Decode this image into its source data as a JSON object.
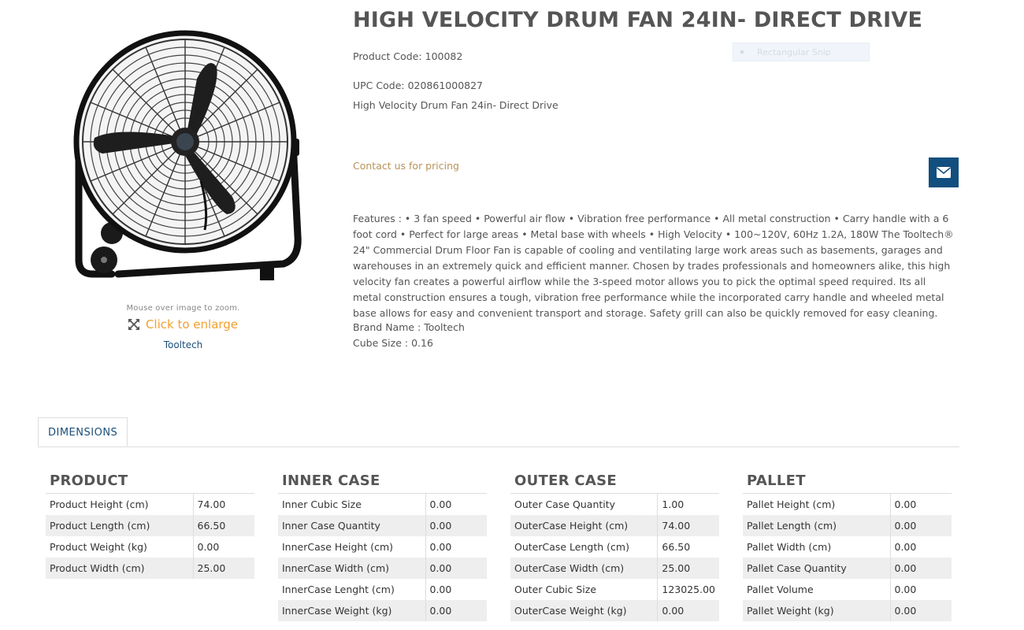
{
  "product": {
    "title": "HIGH VELOCITY DRUM FAN 24IN- DIRECT DRIVE",
    "product_code": "Product Code: 100082",
    "upc_code": "UPC Code: 020861000827",
    "short_description": "High Velocity Drum Fan 24in- Direct Drive",
    "contact_pricing": "Contact us for pricing",
    "features": "Features : • 3 fan speed • Powerful air flow • Vibration free performance • All metal construction • Carry handle with a 6 foot cord • Perfect for large areas • Metal base with wheels • High Velocity • 100~120V, 60Hz 1.2A, 180W The Tooltech® 24\" Commercial Drum Floor Fan is capable of cooling and ventilating large work areas such as basements, garages and warehouses in an extremely quick and efficient manner. Chosen by trades professionals and homeowners alike, this high velocity fan creates a powerful airflow while the 3-speed motor allows you to pick the optimal speed required. Its all metal construction ensures a tough, vibration free performance while the incorporated carry handle and wheeled metal base allows for easy and convenient transport and storage. Safety grill can also be quickly removed for easy cleaning.",
    "brand_name": "Brand Name : Tooltech",
    "cube_size": "Cube Size : 0.16"
  },
  "image_panel": {
    "zoom_hint": "Mouse over image to zoom.",
    "enlarge_label": "Click to enlarge",
    "brand_link": "Tooltech"
  },
  "overlay": {
    "snip_label": "Rectangular Snip"
  },
  "tabs": [
    {
      "label": "DIMENSIONS"
    }
  ],
  "dimensions": {
    "product": {
      "title": "PRODUCT",
      "rows": [
        {
          "label": "Product Height (cm)",
          "value": "74.00"
        },
        {
          "label": "Product Length (cm)",
          "value": "66.50"
        },
        {
          "label": "Product Weight (kg)",
          "value": "0.00"
        },
        {
          "label": "Product Width (cm)",
          "value": "25.00"
        }
      ]
    },
    "inner_case": {
      "title": "INNER CASE",
      "rows": [
        {
          "label": "Inner Cubic Size",
          "value": "0.00"
        },
        {
          "label": "Inner Case Quantity",
          "value": "0.00"
        },
        {
          "label": "InnerCase Height (cm)",
          "value": "0.00"
        },
        {
          "label": "InnerCase Width (cm)",
          "value": "0.00"
        },
        {
          "label": "InnerCase Lenght (cm)",
          "value": "0.00"
        },
        {
          "label": "InnerCase Weight (kg)",
          "value": "0.00"
        }
      ]
    },
    "outer_case": {
      "title": "OUTER CASE",
      "rows": [
        {
          "label": "Outer Case Quantity",
          "value": "1.00"
        },
        {
          "label": "OuterCase Height (cm)",
          "value": "74.00"
        },
        {
          "label": "OuterCase Length (cm)",
          "value": "66.50"
        },
        {
          "label": "OuterCase Width (cm)",
          "value": "25.00"
        },
        {
          "label": "Outer Cubic Size",
          "value": "123025.00"
        },
        {
          "label": "OuterCase Weight (kg)",
          "value": "0.00"
        }
      ]
    },
    "pallet": {
      "title": "PALLET",
      "rows": [
        {
          "label": "Pallet Height (cm)",
          "value": "0.00"
        },
        {
          "label": "Pallet Length (cm)",
          "value": "0.00"
        },
        {
          "label": "Pallet Width (cm)",
          "value": "0.00"
        },
        {
          "label": "Pallet Case Quantity",
          "value": "0.00"
        },
        {
          "label": "Pallet Volume",
          "value": "0.00"
        },
        {
          "label": "Pallet Weight (kg)",
          "value": "0.00"
        }
      ]
    }
  },
  "colors": {
    "accent_blue": "#124f7e",
    "link_blue": "#1b4f7a",
    "pricing_tan": "#b8935a",
    "enlarge_orange": "#f0a030"
  }
}
